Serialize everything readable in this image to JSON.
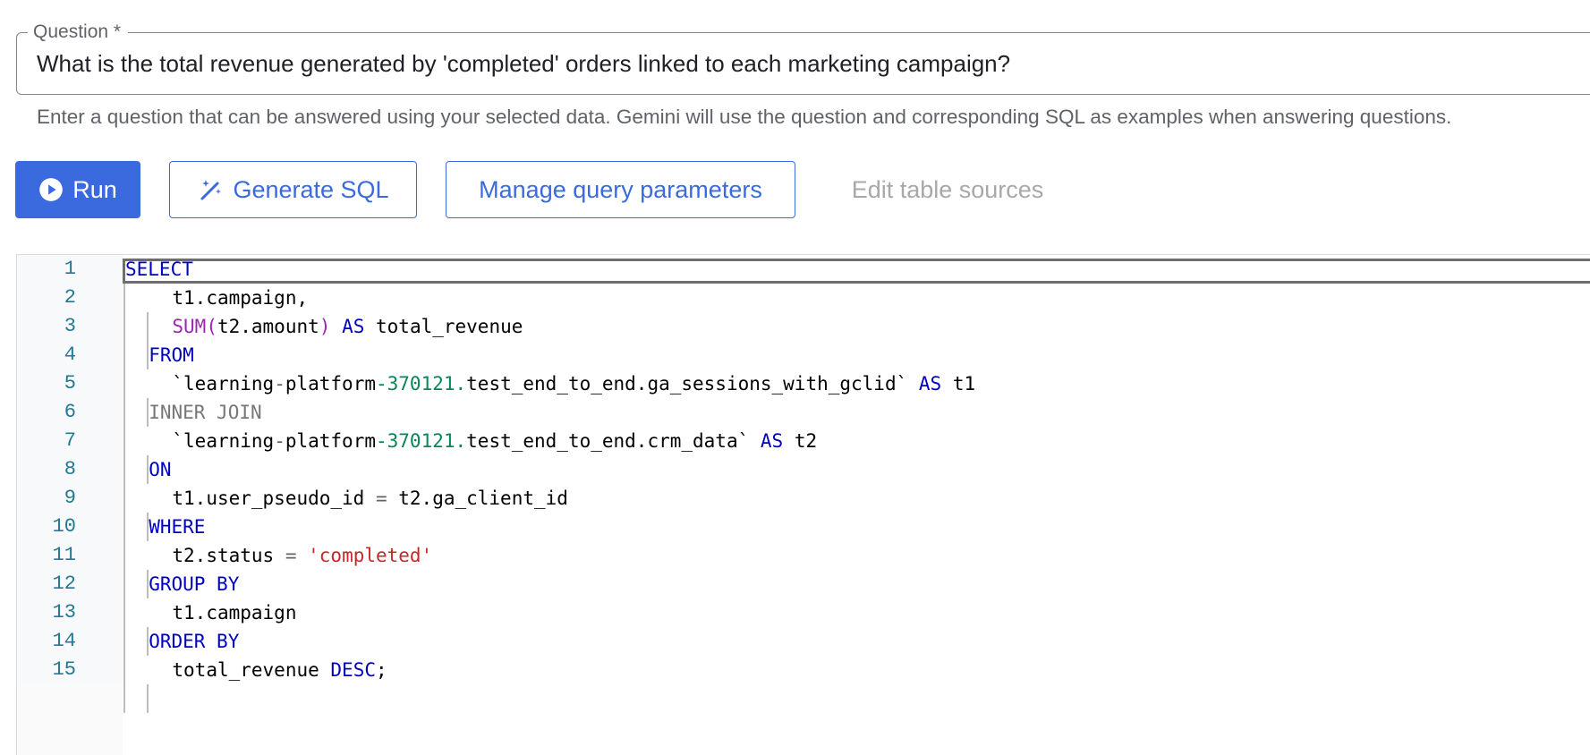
{
  "question": {
    "label": "Question *",
    "value": "What is the total revenue generated by 'completed' orders linked to each marketing campaign?",
    "helper": "Enter a question that can be answered using your selected data. Gemini will use the question and corresponding SQL as examples when answering questions."
  },
  "toolbar": {
    "run_label": "Run",
    "generate_label": "Generate SQL",
    "manage_label": "Manage query parameters",
    "edit_sources_label": "Edit table sources"
  },
  "colors": {
    "accent": "#3b6ade",
    "keyword": "#0000c0",
    "function": "#9c27b0",
    "number": "#098658",
    "string": "#c62828"
  },
  "editor": {
    "line_numbers": [
      "1",
      "2",
      "3",
      "4",
      "5",
      "6",
      "7",
      "8",
      "9",
      "10",
      "11",
      "12",
      "13",
      "14",
      "15"
    ],
    "lines": [
      {
        "indent": 0,
        "tokens": [
          {
            "t": "SELECT",
            "c": "kw"
          }
        ]
      },
      {
        "indent": 2,
        "tokens": [
          {
            "t": "t1.campaign,",
            "c": ""
          }
        ]
      },
      {
        "indent": 2,
        "tokens": [
          {
            "t": "SUM(",
            "c": "fn"
          },
          {
            "t": "t2.amount",
            "c": ""
          },
          {
            "t": ")",
            "c": "fn"
          },
          {
            "t": " ",
            "c": ""
          },
          {
            "t": "AS",
            "c": "kw"
          },
          {
            "t": " total_revenue",
            "c": ""
          }
        ]
      },
      {
        "indent": 1,
        "tokens": [
          {
            "t": "FROM",
            "c": "kw"
          }
        ]
      },
      {
        "indent": 2,
        "tokens": [
          {
            "t": "`learning",
            "c": ""
          },
          {
            "t": "-",
            "c": "op"
          },
          {
            "t": "platform",
            "c": ""
          },
          {
            "t": "-370121.",
            "c": "num"
          },
          {
            "t": "test_end_to_end.ga_sessions_with_gclid`",
            "c": ""
          },
          {
            "t": " ",
            "c": ""
          },
          {
            "t": "AS",
            "c": "kw"
          },
          {
            "t": " t1",
            "c": ""
          }
        ]
      },
      {
        "indent": 1,
        "tokens": [
          {
            "t": "INNER JOIN",
            "c": "dim"
          }
        ]
      },
      {
        "indent": 2,
        "tokens": [
          {
            "t": "`learning",
            "c": ""
          },
          {
            "t": "-",
            "c": "op"
          },
          {
            "t": "platform",
            "c": ""
          },
          {
            "t": "-370121.",
            "c": "num"
          },
          {
            "t": "test_end_to_end.crm_data`",
            "c": ""
          },
          {
            "t": " ",
            "c": ""
          },
          {
            "t": "AS",
            "c": "kw"
          },
          {
            "t": " t2",
            "c": ""
          }
        ]
      },
      {
        "indent": 1,
        "tokens": [
          {
            "t": "ON",
            "c": "kw"
          }
        ]
      },
      {
        "indent": 2,
        "tokens": [
          {
            "t": "t1.user_pseudo_id ",
            "c": ""
          },
          {
            "t": "=",
            "c": "op"
          },
          {
            "t": " t2.ga_client_id",
            "c": ""
          }
        ]
      },
      {
        "indent": 1,
        "tokens": [
          {
            "t": "WHERE",
            "c": "kw"
          }
        ]
      },
      {
        "indent": 2,
        "tokens": [
          {
            "t": "t2.status ",
            "c": ""
          },
          {
            "t": "=",
            "c": "op"
          },
          {
            "t": " ",
            "c": ""
          },
          {
            "t": "'completed'",
            "c": "str"
          }
        ]
      },
      {
        "indent": 1,
        "tokens": [
          {
            "t": "GROUP BY",
            "c": "kw"
          }
        ]
      },
      {
        "indent": 2,
        "tokens": [
          {
            "t": "t1.campaign",
            "c": ""
          }
        ]
      },
      {
        "indent": 1,
        "tokens": [
          {
            "t": "ORDER BY",
            "c": "kw"
          }
        ]
      },
      {
        "indent": 2,
        "tokens": [
          {
            "t": "total_revenue ",
            "c": ""
          },
          {
            "t": "DESC",
            "c": "kw"
          },
          {
            "t": ";",
            "c": ""
          }
        ]
      }
    ]
  }
}
